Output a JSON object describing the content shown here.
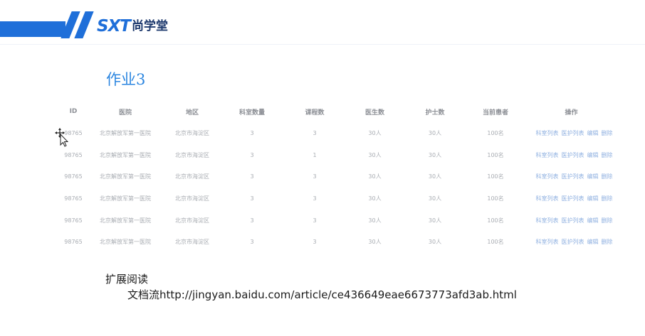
{
  "header": {
    "logo_mark": "SXT",
    "logo_text": "尚学堂",
    "brand_color": "#1f6fd9"
  },
  "page": {
    "title": "作业3"
  },
  "table": {
    "columns": [
      "ID",
      "医院",
      "地区",
      "科室数量",
      "课程数",
      "医生数",
      "护士数",
      "当前患者",
      "操作"
    ],
    "rows": [
      [
        "98765",
        "北京解放军第一医院",
        "北京市海淀区",
        "3",
        "3",
        "30人",
        "30人",
        "100名"
      ],
      [
        "98765",
        "北京解放军第一医院",
        "北京市海淀区",
        "3",
        "1",
        "30人",
        "30人",
        "100名"
      ],
      [
        "98765",
        "北京解放军第一医院",
        "北京市海淀区",
        "3",
        "3",
        "30人",
        "30人",
        "100名"
      ],
      [
        "98765",
        "北京解放军第一医院",
        "北京市海淀区",
        "3",
        "3",
        "30人",
        "30人",
        "100名"
      ],
      [
        "98765",
        "北京解放军第一医院",
        "北京市海淀区",
        "3",
        "3",
        "30人",
        "30人",
        "100名"
      ],
      [
        "98765",
        "北京解放军第一医院",
        "北京市海淀区",
        "3",
        "3",
        "30人",
        "30人",
        "100名"
      ]
    ],
    "actions": [
      "科室列表",
      "医护列表",
      "编辑",
      "删除"
    ],
    "link_color": "#8fb0e0"
  },
  "extended": {
    "title": "扩展阅读",
    "prefix": "文档流",
    "url": "http://jingyan.baidu.com/article/ce436649eae6673773afd3ab.html"
  }
}
